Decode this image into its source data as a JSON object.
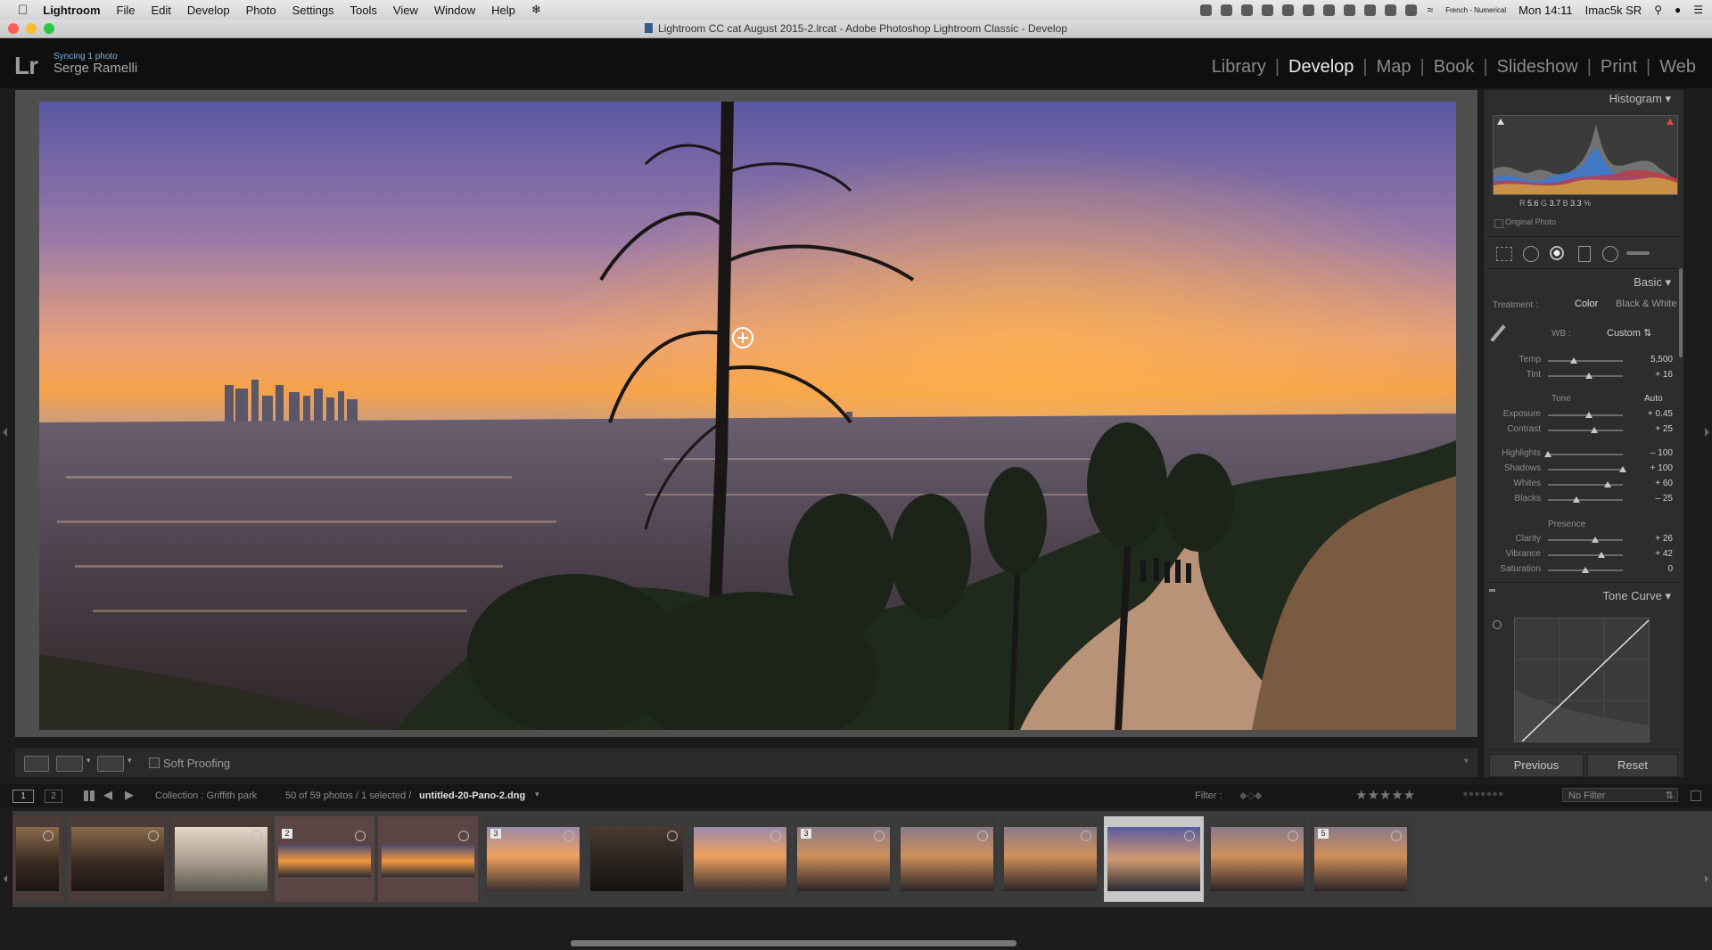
{
  "menubar": {
    "app": "Lightroom",
    "menus": [
      "File",
      "Edit",
      "Develop",
      "Photo",
      "Settings",
      "Tools",
      "View",
      "Window",
      "Help"
    ],
    "keyboard": "French - Numerical",
    "clock": "Mon 14:11",
    "computer": "Imac5k SR"
  },
  "window": {
    "title": "Lightroom CC cat August 2015-2.lrcat - Adobe Photoshop Lightroom Classic - Develop"
  },
  "identity": {
    "logo": "Lr",
    "status": "Syncing 1 photo",
    "user": "Serge Ramelli"
  },
  "modules": [
    "Library",
    "Develop",
    "Map",
    "Book",
    "Slideshow",
    "Print",
    "Web"
  ],
  "active_module": "Develop",
  "toolbar": {
    "soft_proofing": "Soft Proofing"
  },
  "panels": {
    "histogram": {
      "title": "Histogram",
      "readout": {
        "r_label": "R",
        "r": "5.6",
        "g_label": "G",
        "g": "3.7",
        "b_label": "B",
        "b": "3.3",
        "unit": "%"
      },
      "original_photo": "Original Photo"
    },
    "basic": {
      "title": "Basic",
      "treatment_label": "Treatment :",
      "color": "Color",
      "bw": "Black & White",
      "wb_label": "WB :",
      "wb_value": "Custom",
      "tone_label": "Tone",
      "auto": "Auto",
      "presence_label": "Presence",
      "wb_sliders": [
        {
          "label": "Temp",
          "value": "5,500",
          "pos": 0.35
        },
        {
          "label": "Tint",
          "value": "+ 16",
          "pos": 0.55
        }
      ],
      "tone_sliders": [
        {
          "label": "Exposure",
          "value": "+ 0.45",
          "pos": 0.55
        },
        {
          "label": "Contrast",
          "value": "+ 25",
          "pos": 0.62
        }
      ],
      "hs_sliders": [
        {
          "label": "Highlights",
          "value": "– 100",
          "pos": 0.0
        },
        {
          "label": "Shadows",
          "value": "+ 100",
          "pos": 1.0
        },
        {
          "label": "Whites",
          "value": "+ 60",
          "pos": 0.8
        },
        {
          "label": "Blacks",
          "value": "– 25",
          "pos": 0.38
        }
      ],
      "presence_sliders": [
        {
          "label": "Clarity",
          "value": "+ 26",
          "pos": 0.63
        },
        {
          "label": "Vibrance",
          "value": "+ 42",
          "pos": 0.71
        },
        {
          "label": "Saturation",
          "value": "0",
          "pos": 0.5
        }
      ]
    },
    "tone_curve": {
      "title": "Tone Curve"
    },
    "previous": "Previous",
    "reset": "Reset"
  },
  "filmstrip": {
    "pages": [
      "1",
      "2"
    ],
    "collection": "Collection : Griffith park",
    "count": "50 of 59 photos / 1 selected /",
    "filename": "untitled-20-Pano-2.dng",
    "filter_label": "Filter :",
    "filter_value": "No Filter",
    "thumbs": [
      {
        "badge": "",
        "tone": "dusk-dark"
      },
      {
        "badge": "",
        "tone": "dusk-dark"
      },
      {
        "badge": "",
        "tone": "hazy"
      },
      {
        "badge": "2",
        "tone": "pano"
      },
      {
        "badge": "",
        "tone": "pano"
      },
      {
        "badge": "3",
        "tone": "sunset-city"
      },
      {
        "badge": "",
        "tone": "dark"
      },
      {
        "badge": "",
        "tone": "sunset-city"
      },
      {
        "badge": "3",
        "tone": "sunset"
      },
      {
        "badge": "",
        "tone": "sunset"
      },
      {
        "badge": "",
        "tone": "sunset"
      },
      {
        "badge": "",
        "tone": "selected-purple"
      },
      {
        "badge": "",
        "tone": "sunset"
      },
      {
        "badge": "5",
        "tone": "sunset"
      }
    ]
  },
  "colors": {
    "accent": "#e8e8e8",
    "panel": "#2d2d2d",
    "background": "#1c1c1c"
  }
}
